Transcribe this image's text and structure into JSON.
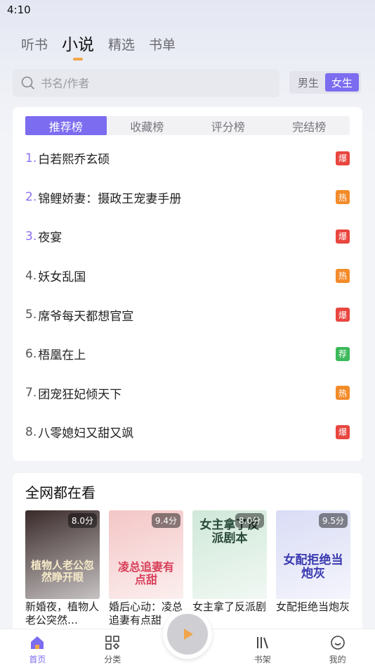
{
  "status_bar": {
    "time": "4:10"
  },
  "top_tabs": [
    "听书",
    "小说",
    "精选",
    "书单"
  ],
  "search": {
    "placeholder": "书名/作者"
  },
  "gender": {
    "male": "男生",
    "female": "女生"
  },
  "rank_tabs": [
    "推荐榜",
    "收藏榜",
    "评分榜",
    "完结榜"
  ],
  "rank_list": [
    {
      "num": "1.",
      "title": "白若熙乔玄硕",
      "badge": "爆",
      "badge_color": "#e8463f"
    },
    {
      "num": "2.",
      "title": "锦鲤娇妻：摄政王宠妻手册",
      "badge": "热",
      "badge_color": "#f38b2a"
    },
    {
      "num": "3.",
      "title": "夜宴",
      "badge": "爆",
      "badge_color": "#e8463f"
    },
    {
      "num": "4.",
      "title": "妖女乱国",
      "badge": "热",
      "badge_color": "#f38b2a"
    },
    {
      "num": "5.",
      "title": "席爷每天都想官宣",
      "badge": "爆",
      "badge_color": "#e8463f"
    },
    {
      "num": "6.",
      "title": "梧凰在上",
      "badge": "荐",
      "badge_color": "#3cb95a"
    },
    {
      "num": "7.",
      "title": "团宠狂妃倾天下",
      "badge": "热",
      "badge_color": "#f38b2a"
    },
    {
      "num": "8.",
      "title": "八零媳妇又甜又飒",
      "badge": "爆",
      "badge_color": "#e8463f"
    }
  ],
  "hot_section": {
    "title": "全网都在看",
    "books": [
      {
        "score": "8.0分",
        "title": "新婚夜，植物人老公突然…",
        "cover_text": "植物人老公忽然睁开眼",
        "cover_color": "#3a2a2a"
      },
      {
        "score": "9.4分",
        "title": "婚后心动：凌总追妻有点甜",
        "cover_text": "凌总追妻有点甜",
        "cover_color": "#f4c6c6"
      },
      {
        "score": "8.0分",
        "title": "女主拿了反派剧本",
        "cover_text": "女主拿了反派剧本",
        "cover_color": "#cfe8d8"
      },
      {
        "score": "9.5分",
        "title": "女配拒绝当炮灰",
        "cover_text": "女配拒绝当炮灰",
        "cover_color": "#d9dcf5"
      }
    ]
  },
  "bottom_nav": {
    "home": "首页",
    "category": "分类",
    "shelf": "书架",
    "mine": "我的"
  },
  "colors": {
    "accent": "#7b6cf0",
    "orange": "#f0a54a"
  }
}
